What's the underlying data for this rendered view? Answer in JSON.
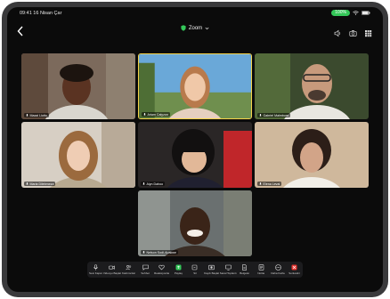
{
  "status": {
    "time": "09:41",
    "date": "16 Nisan Çar",
    "battery": "100%"
  },
  "header": {
    "title": "Zoom",
    "accent_green": "#34c759"
  },
  "participants": [
    "Mazai Liotto",
    "Ariam Calyzon",
    "Gabriel Malmborn",
    "Maria Dilebmeza",
    "Alyn Dahoo",
    "Elena Leval",
    "Nelson Sodi-Apakwe"
  ],
  "controls": [
    {
      "label": "Sesi Kapat",
      "icon": "mic-icon"
    },
    {
      "label": "Videoyu Başlat",
      "icon": "video-icon"
    },
    {
      "label": "Katılımcılar",
      "icon": "participants-icon"
    },
    {
      "label": "Sohbet",
      "icon": "chat-icon"
    },
    {
      "label": "Reaksiyonlar",
      "icon": "heart-icon"
    },
    {
      "label": "Paylaş",
      "icon": "share-icon"
    },
    {
      "label": "Sil",
      "icon": "delete-icon"
    },
    {
      "label": "Kaydı Başlat",
      "icon": "record-icon"
    },
    {
      "label": "Sanal Toplantı",
      "icon": "screen-icon"
    },
    {
      "label": "Belgeler",
      "icon": "doc-icon"
    },
    {
      "label": "Notlar",
      "icon": "note-icon"
    },
    {
      "label": "Daha Fazla",
      "icon": "more-icon"
    },
    {
      "label": "Sonlandır",
      "icon": "end-icon"
    }
  ]
}
